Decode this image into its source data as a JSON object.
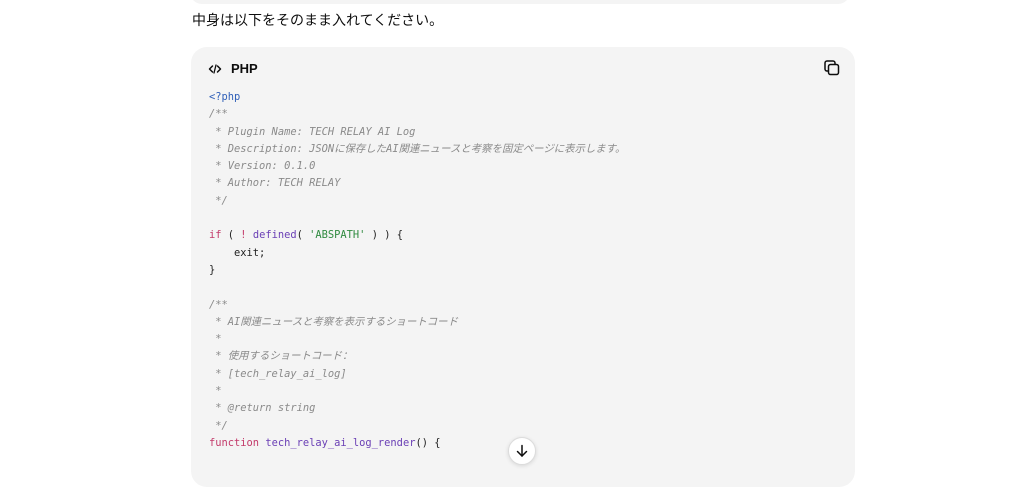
{
  "intro_text": "中身は以下をそのまま入れてください。",
  "code_block": {
    "language": "PHP",
    "lines": [
      [
        {
          "t": "<?php",
          "c": "tag"
        }
      ],
      [
        {
          "t": "/**",
          "c": "comment"
        }
      ],
      [
        {
          "t": " * Plugin Name: TECH RELAY AI Log",
          "c": "comment"
        }
      ],
      [
        {
          "t": " * Description: JSONに保存したAI関連ニュースと考察を固定ページに表示します。",
          "c": "comment"
        }
      ],
      [
        {
          "t": " * Version: 0.1.0",
          "c": "comment"
        }
      ],
      [
        {
          "t": " * Author: TECH RELAY",
          "c": "comment"
        }
      ],
      [
        {
          "t": " */",
          "c": "comment"
        }
      ],
      [],
      [
        {
          "t": "if",
          "c": "kw"
        },
        {
          "t": " ( ",
          "c": "plain"
        },
        {
          "t": "!",
          "c": "kw"
        },
        {
          "t": " ",
          "c": "plain"
        },
        {
          "t": "defined",
          "c": "fn"
        },
        {
          "t": "( ",
          "c": "plain"
        },
        {
          "t": "'ABSPATH'",
          "c": "str"
        },
        {
          "t": " ) ) {",
          "c": "plain"
        }
      ],
      [
        {
          "t": "    exit;",
          "c": "plain"
        }
      ],
      [
        {
          "t": "}",
          "c": "plain"
        }
      ],
      [],
      [
        {
          "t": "/**",
          "c": "comment"
        }
      ],
      [
        {
          "t": " * AI関連ニュースと考察を表示するショートコード",
          "c": "comment"
        }
      ],
      [
        {
          "t": " *",
          "c": "comment"
        }
      ],
      [
        {
          "t": " * 使用するショートコード：",
          "c": "comment"
        }
      ],
      [
        {
          "t": " * [tech_relay_ai_log]",
          "c": "comment"
        }
      ],
      [
        {
          "t": " *",
          "c": "comment"
        }
      ],
      [
        {
          "t": " * @return string",
          "c": "comment"
        }
      ],
      [
        {
          "t": " */",
          "c": "comment"
        }
      ],
      [
        {
          "t": "function",
          "c": "kw"
        },
        {
          "t": " ",
          "c": "plain"
        },
        {
          "t": "tech_relay_ai_log_render",
          "c": "fn"
        },
        {
          "t": "() {",
          "c": "plain"
        }
      ]
    ]
  },
  "icons": {
    "language": "code-brackets-icon",
    "copy": "copy-icon",
    "scroll": "arrow-down-icon"
  },
  "colors": {
    "code_background": "#f4f4f4",
    "comment": "#8a8a8a",
    "keyword": "#c33a6a",
    "function": "#6a3fb5",
    "string": "#2f8a3f",
    "php_tag": "#2f5fb8"
  }
}
